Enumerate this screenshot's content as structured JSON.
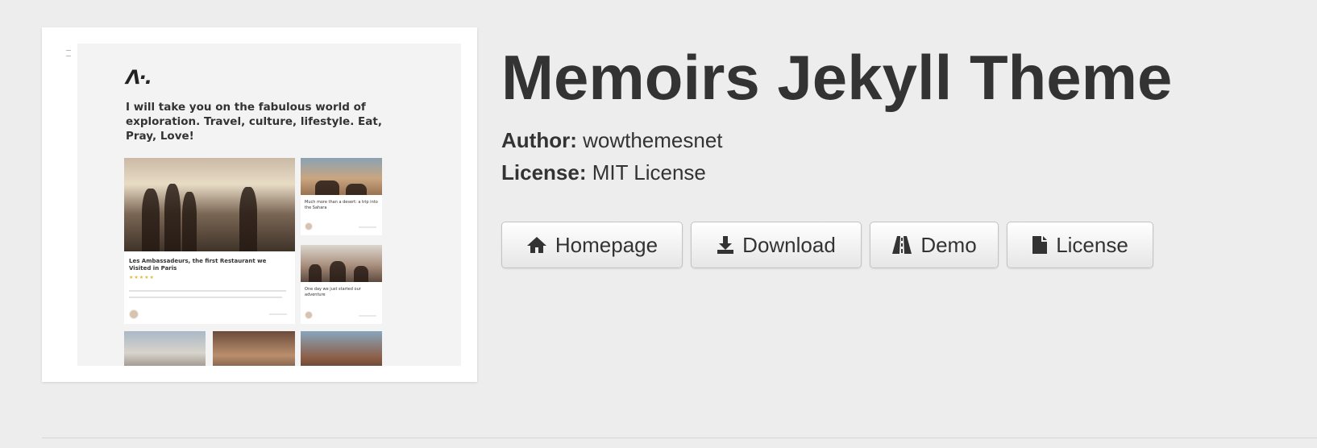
{
  "page": {
    "title": "Memoirs Jekyll Theme",
    "author_label": "Author:",
    "author": "wowthemesnet",
    "license_label": "License:",
    "license": "MIT License"
  },
  "buttons": {
    "homepage": "Homepage",
    "download": "Download",
    "demo": "Demo",
    "license": "License"
  },
  "preview": {
    "logo": "Λ·.",
    "tagline": "I will take you on the fabulous world of exploration. Travel, culture, lifestyle. Eat, Pray, Love!",
    "cards": {
      "featured": {
        "title": "Les Ambassadeurs, the first Restaurant we Visited in Paris",
        "stars": "★★★★★"
      },
      "side1": {
        "title": "Much more than a desert: a trip into the Sahara"
      },
      "side2": {
        "title": "One day we just started our adventure"
      }
    }
  },
  "icons": {
    "homepage": "home-icon",
    "download": "download-icon",
    "demo": "road-icon",
    "license": "file-icon"
  }
}
